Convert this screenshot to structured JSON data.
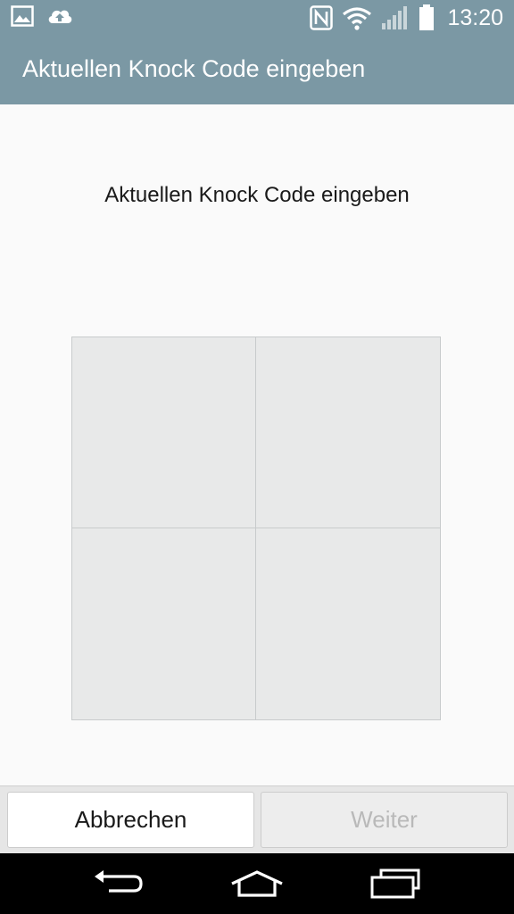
{
  "status_bar": {
    "time": "13:20",
    "left_icons": [
      "image-icon",
      "cloud-upload-icon"
    ],
    "right_icons": [
      "nfc-icon",
      "wifi-icon",
      "signal-icon",
      "battery-icon"
    ]
  },
  "action_bar": {
    "title": "Aktuellen Knock Code eingeben"
  },
  "content": {
    "prompt": "Aktuellen Knock Code eingeben",
    "pad_quadrants": [
      "top-left",
      "top-right",
      "bottom-left",
      "bottom-right"
    ]
  },
  "buttons": {
    "cancel_label": "Abbrechen",
    "next_label": "Weiter",
    "next_enabled": false
  },
  "nav_bar": {
    "icons": [
      "back-icon",
      "home-icon",
      "recent-apps-icon"
    ]
  },
  "colors": {
    "bar": "#7b98a4",
    "pad": "#e8e9e9",
    "disabled_text": "#b9b9b9"
  }
}
